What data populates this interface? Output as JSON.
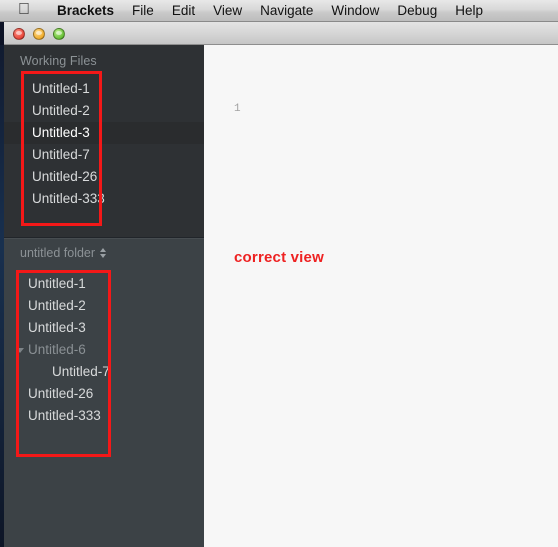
{
  "menubar": {
    "apple_icon": "apple-icon",
    "app_name": "Brackets",
    "items": [
      "File",
      "Edit",
      "View",
      "Navigate",
      "Window",
      "Debug",
      "Help"
    ]
  },
  "window_controls": {
    "close_label": "close",
    "minimize_label": "minimize",
    "zoom_label": "zoom"
  },
  "sidebar": {
    "working_files": {
      "title": "Working Files",
      "items": [
        {
          "label": "Untitled-1",
          "selected": false
        },
        {
          "label": "Untitled-2",
          "selected": false
        },
        {
          "label": "Untitled-3",
          "selected": true
        },
        {
          "label": "Untitled-7",
          "selected": false
        },
        {
          "label": "Untitled-26",
          "selected": false
        },
        {
          "label": "Untitled-333",
          "selected": false
        }
      ]
    },
    "project": {
      "title": "untitled folder",
      "sort_icon": "sort-chevrons-icon",
      "items": [
        {
          "label": "Untitled-1",
          "type": "file",
          "depth": 0
        },
        {
          "label": "Untitled-2",
          "type": "file",
          "depth": 0
        },
        {
          "label": "Untitled-3",
          "type": "file",
          "depth": 0
        },
        {
          "label": "Untitled-6",
          "type": "folder",
          "depth": 0,
          "expanded": true
        },
        {
          "label": "Untitled-7",
          "type": "file",
          "depth": 1
        },
        {
          "label": "Untitled-26",
          "type": "file",
          "depth": 0
        },
        {
          "label": "Untitled-333",
          "type": "file",
          "depth": 0
        }
      ]
    }
  },
  "editor": {
    "line_number": "1",
    "annotation_text": "correct view"
  },
  "annotations": {
    "color": "#f41818",
    "working_files_box": "highlight-working-files",
    "project_tree_box": "highlight-project-tree"
  }
}
